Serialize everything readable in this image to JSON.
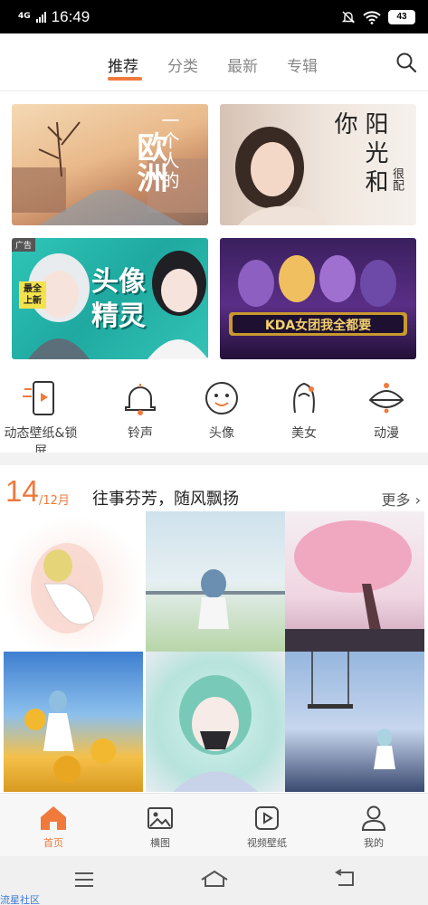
{
  "status_bar": {
    "network": "4G",
    "time": "16:49",
    "battery": "43"
  },
  "top_tabs": [
    "推荐",
    "分类",
    "最新",
    "专辑"
  ],
  "banners": {
    "europe": {
      "line1": "一个人的",
      "line2": "欧洲"
    },
    "sunshine": {
      "line1": "阳光和你",
      "line2": "很配"
    },
    "avatar_sprite": {
      "tag": "广告",
      "badge": "最全上新",
      "title": "头像精灵"
    },
    "kda": {
      "title": "KDA女团我全都要"
    }
  },
  "categories": [
    "动态壁纸&锁屏",
    "铃声",
    "头像",
    "美女",
    "动漫"
  ],
  "section": {
    "day": "14",
    "month": "/12月",
    "title": "往事芬芳，随风飘扬",
    "more": "更多"
  },
  "bottom_nav": [
    "首页",
    "横图",
    "视频壁纸",
    "我的"
  ],
  "watermark": "流星社区",
  "colors": {
    "accent": "#f07a3c"
  }
}
